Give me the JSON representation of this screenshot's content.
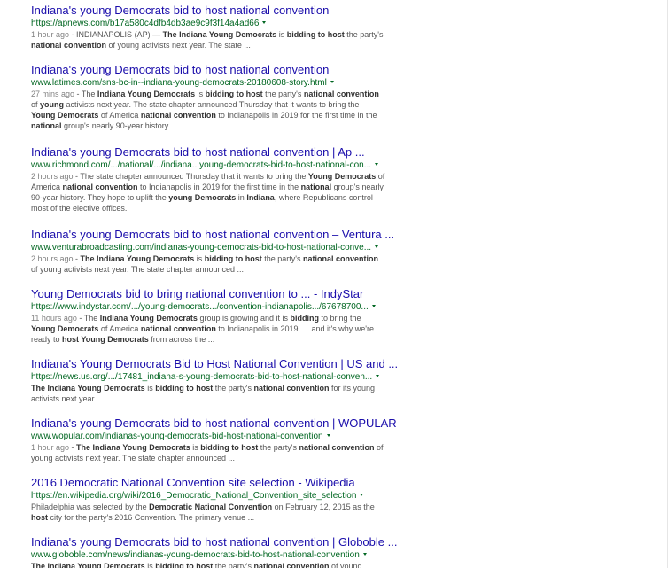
{
  "results": [
    {
      "title": "Indiana's young Democrats bid to host national convention",
      "url": "https://apnews.com/b17a580c4dfb4db3ae9c9f3f14a4ad66",
      "snippet": [
        {
          "t": "1 hour ago",
          "s": "ago"
        },
        {
          "t": " - INDIANAPOLIS (AP) — "
        },
        {
          "t": "The Indiana Young Democrats",
          "s": "b"
        },
        {
          "t": " is "
        },
        {
          "t": "bidding to host",
          "s": "b"
        },
        {
          "t": " the party's "
        },
        {
          "t": "national convention",
          "s": "b"
        },
        {
          "t": " of young activists next year. The state ..."
        }
      ]
    },
    {
      "title": "Indiana's young Democrats bid to host national convention",
      "url": "www.latimes.com/sns-bc-in--indiana-young-democrats-20180608-story.html",
      "snippet": [
        {
          "t": "27 mins ago",
          "s": "ago"
        },
        {
          "t": " - The "
        },
        {
          "t": "Indiana Young Democrats",
          "s": "b"
        },
        {
          "t": " is "
        },
        {
          "t": "bidding to host",
          "s": "b"
        },
        {
          "t": " the party's "
        },
        {
          "t": "national convention",
          "s": "b"
        },
        {
          "t": " of "
        },
        {
          "t": "young",
          "s": "b"
        },
        {
          "t": " activists next year. The state chapter announced Thursday that it wants to bring the "
        },
        {
          "t": "Young Democrats",
          "s": "b"
        },
        {
          "t": " of America "
        },
        {
          "t": "national convention",
          "s": "b"
        },
        {
          "t": " to Indianapolis in 2019 for the first time in the "
        },
        {
          "t": "national",
          "s": "b"
        },
        {
          "t": " group's nearly 90-year history."
        }
      ]
    },
    {
      "title": "Indiana's young Democrats bid to host national convention | Ap ...",
      "url": "www.richmond.com/.../national/.../indiana...young-democrats-bid-to-host-national-con...",
      "snippet": [
        {
          "t": "2 hours ago",
          "s": "ago"
        },
        {
          "t": " - The state chapter announced Thursday that it wants to bring the "
        },
        {
          "t": "Young Democrats",
          "s": "b"
        },
        {
          "t": " of America "
        },
        {
          "t": "national convention",
          "s": "b"
        },
        {
          "t": " to Indianapolis in 2019 for the first time in the "
        },
        {
          "t": "national",
          "s": "b"
        },
        {
          "t": " group's nearly 90-year history. They hope to uplift the "
        },
        {
          "t": "young Democrats",
          "s": "b"
        },
        {
          "t": " in "
        },
        {
          "t": "Indiana",
          "s": "b"
        },
        {
          "t": ", where Republicans control most of the elective offices."
        }
      ]
    },
    {
      "title": "Indiana's young Democrats bid to host national convention – Ventura ...",
      "url": "www.venturabroadcasting.com/indianas-young-democrats-bid-to-host-national-conve...",
      "snippet": [
        {
          "t": "2 hours ago",
          "s": "ago"
        },
        {
          "t": " - "
        },
        {
          "t": "The Indiana Young Democrats",
          "s": "b"
        },
        {
          "t": " is "
        },
        {
          "t": "bidding to host",
          "s": "b"
        },
        {
          "t": " the party's "
        },
        {
          "t": "national convention",
          "s": "b"
        },
        {
          "t": " of young activists next year. The state chapter announced ..."
        }
      ]
    },
    {
      "title": "Young Democrats bid to bring national convention to ... - IndyStar",
      "url": "https://www.indystar.com/.../young-democrats.../convention-indianapolis.../67678700...",
      "snippet": [
        {
          "t": "11 hours ago",
          "s": "ago"
        },
        {
          "t": " - The "
        },
        {
          "t": "Indiana Young Democrats",
          "s": "b"
        },
        {
          "t": " group is growing and it is "
        },
        {
          "t": "bidding",
          "s": "b"
        },
        {
          "t": " to bring the "
        },
        {
          "t": "Young Democrats",
          "s": "b"
        },
        {
          "t": " of America "
        },
        {
          "t": "national convention",
          "s": "b"
        },
        {
          "t": " to Indianapolis in 2019. ... and it's why we're ready to "
        },
        {
          "t": "host Young Democrats",
          "s": "b"
        },
        {
          "t": " from across the ..."
        }
      ]
    },
    {
      "title": "Indiana's Young Democrats Bid to Host National Convention | US and ...",
      "url": "https://news.us.org/.../17481_indiana-s-young-democrats-bid-to-host-national-conven...",
      "snippet": [
        {
          "t": "The Indiana Young Democrats",
          "s": "b"
        },
        {
          "t": " is "
        },
        {
          "t": "bidding to host",
          "s": "b"
        },
        {
          "t": " the party's "
        },
        {
          "t": "national convention",
          "s": "b"
        },
        {
          "t": " for its young activists next year."
        }
      ]
    },
    {
      "title": "Indiana's young Democrats bid to host national convention | WOPULAR",
      "url": "www.wopular.com/indianas-young-democrats-bid-host-national-convention",
      "snippet": [
        {
          "t": "1 hour ago",
          "s": "ago"
        },
        {
          "t": " - "
        },
        {
          "t": "The Indiana Young Democrats",
          "s": "b"
        },
        {
          "t": " is "
        },
        {
          "t": "bidding to host",
          "s": "b"
        },
        {
          "t": " the party's "
        },
        {
          "t": "national convention",
          "s": "b"
        },
        {
          "t": " of young activists next year. The state chapter announced ..."
        }
      ]
    },
    {
      "title": "2016 Democratic National Convention site selection - Wikipedia",
      "url": "https://en.wikipedia.org/wiki/2016_Democratic_National_Convention_site_selection",
      "snippet": [
        {
          "t": "Philadelphia was selected by the "
        },
        {
          "t": "Democratic National Convention",
          "s": "b"
        },
        {
          "t": " on February 12, 2015 as the "
        },
        {
          "t": "host",
          "s": "b"
        },
        {
          "t": " city for the party's 2016 Convention. The primary venue ..."
        }
      ]
    },
    {
      "title": "Indiana's young Democrats bid to host national convention | Globoble ...",
      "url": "www.globoble.com/news/indianas-young-democrats-bid-to-host-national-convention",
      "snippet": [
        {
          "t": "The Indiana Young Democrats",
          "s": "b"
        },
        {
          "t": " is "
        },
        {
          "t": "bidding to host",
          "s": "b"
        },
        {
          "t": " the party's "
        },
        {
          "t": "national convention",
          "s": "b"
        },
        {
          "t": " of young"
        }
      ]
    }
  ],
  "icons": {
    "url_menu": "caret-down-icon"
  },
  "colors": {
    "title": "#1a0dab",
    "url": "#006621",
    "snippet": "#545454"
  }
}
